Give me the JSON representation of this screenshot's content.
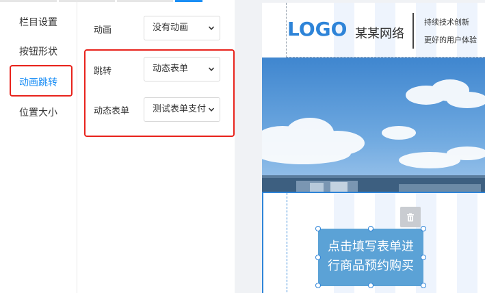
{
  "settings": {
    "tabs": [
      {
        "label": "栏目设置"
      },
      {
        "label": "按钮形状"
      },
      {
        "label": "动画跳转"
      },
      {
        "label": "位置大小"
      }
    ],
    "rows": {
      "animation": {
        "label": "动画",
        "value": "没有动画"
      },
      "jump": {
        "label": "跳转",
        "value": "动态表单"
      },
      "form": {
        "label": "动态表单",
        "value": "测试表单支付"
      }
    }
  },
  "preview": {
    "logo": "LOGO",
    "brand": "某某网络",
    "slogan_line1": "持续技术创新",
    "slogan_line2": "更好的用户体验",
    "cta_line1": "点击填写表单进",
    "cta_line2": "行商品预约购买"
  },
  "colors": {
    "accent": "#1a8ef5",
    "highlight": "#e8221b",
    "cta_bg": "#5ba2d6",
    "logo": "#2e84d8"
  }
}
